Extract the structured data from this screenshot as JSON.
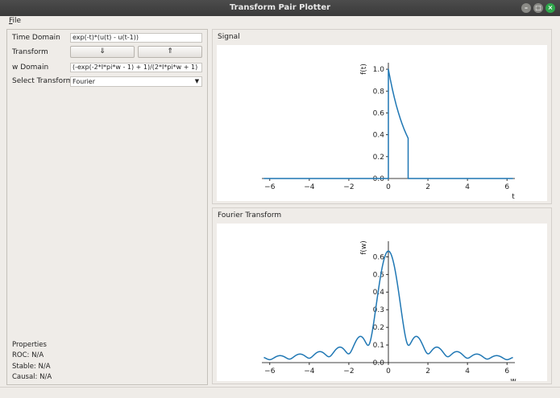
{
  "window": {
    "title": "Transform Pair Plotter"
  },
  "menu": {
    "file": "File"
  },
  "controls": {
    "time_label": "Time Domain",
    "time_value": "exp(-t)*(u(t) - u(t-1))",
    "transform_label": "Transform",
    "down_button": "⇓",
    "up_button": "⇑",
    "w_label": "w Domain",
    "w_value": "(-exp(-2*I*pi*w - 1) + 1)/(2*I*pi*w + 1)",
    "select_label": "Select Transform",
    "select_value": "Fourier"
  },
  "properties": {
    "heading": "Properties",
    "roc": "ROC: N/A",
    "stable": "Stable: N/A",
    "causal": "Causal: N/A"
  },
  "signal_panel": {
    "title": "Signal"
  },
  "transform_panel": {
    "title": "Fourier Transform"
  },
  "chart_data": [
    {
      "type": "line",
      "title": "",
      "xlabel": "t",
      "ylabel": "f(t)",
      "xlim": [
        -6.4,
        6.4
      ],
      "ylim": [
        0,
        1.03
      ],
      "xticks": [
        -6,
        -4,
        -2,
        0,
        2,
        4,
        6
      ],
      "xtick_labels": [
        "−6",
        "−4",
        "−2",
        "0",
        "2",
        "4",
        "6"
      ],
      "yticks": [
        0.2,
        0.4,
        0.6,
        0.8,
        1.0
      ],
      "ytick_labels": [
        "0.2",
        "0.4",
        "0.6",
        "0.8",
        "1.0"
      ],
      "y0_label": "0.0",
      "color": "#1f77b4",
      "series": [
        {
          "x": [
            -6.3,
            0,
            0,
            0.1,
            0.2,
            0.3,
            0.4,
            0.5,
            0.6,
            0.7,
            0.8,
            0.9,
            1.0,
            1.0,
            6.3
          ],
          "y": [
            0,
            0,
            1.0,
            0.905,
            0.819,
            0.741,
            0.67,
            0.607,
            0.549,
            0.497,
            0.449,
            0.407,
            0.368,
            0,
            0
          ]
        }
      ]
    },
    {
      "type": "line",
      "title": "",
      "xlabel": "w",
      "ylabel": "f(w)",
      "xlim": [
        -6.4,
        6.4
      ],
      "ylim": [
        0,
        0.67
      ],
      "xticks": [
        -6,
        -4,
        -2,
        0,
        2,
        4,
        6
      ],
      "xtick_labels": [
        "−6",
        "−4",
        "−2",
        "0",
        "2",
        "4",
        "6"
      ],
      "yticks": [
        0.1,
        0.2,
        0.3,
        0.4,
        0.5,
        0.6
      ],
      "ytick_labels": [
        "0.1",
        "0.2",
        "0.3",
        "0.4",
        "0.5",
        "0.6"
      ],
      "y0_label": "0.0",
      "color": "#1f77b4",
      "function": "|(1 - exp(-2*I*pi*w - 1)) / (2*I*pi*w + 1)|",
      "x_range": [
        -6.3,
        6.3
      ]
    }
  ]
}
